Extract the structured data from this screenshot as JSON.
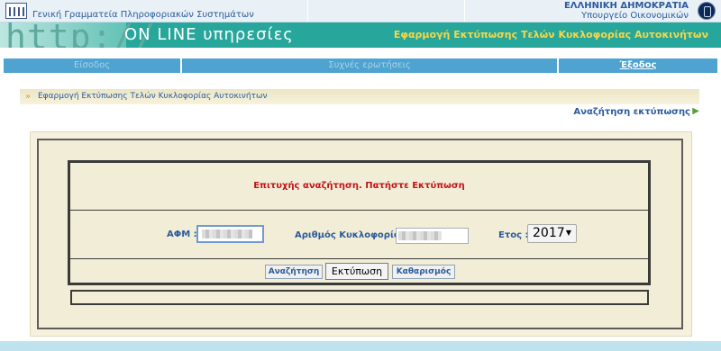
{
  "header": {
    "org_name": "Γενική Γραμματεία Πληροφοριακών Συστημάτων",
    "gov_name": "ΕΛΛΗΝΙΚΗ ΔΗΜΟΚΡΑΤΙΑ",
    "ministry": "Υπουργείο Οικονομικών",
    "logo_icon": "gsis-logo-icon",
    "crest_icon": "greek-crest-icon"
  },
  "banner": {
    "http_text": "http://",
    "online_text": "ON LINE υπηρεσίες",
    "app_title": "Εφαρμογή Εκτύπωσης Τελών Κυκλοφορίας Αυτοκινήτων"
  },
  "nav": {
    "items": [
      {
        "label": "Είσοδος",
        "active": false
      },
      {
        "label": "Συχνές ερωτήσεις",
        "active": false
      },
      {
        "label": "Έξοδος",
        "active": true
      }
    ]
  },
  "breadcrumb": {
    "icon": "double-chevron-right-icon",
    "text": "Εφαρμογή Εκτύπωσης Τελών Κυκλοφορίας Αυτοκινήτων"
  },
  "search_link": {
    "label": "Αναζήτηση εκτύπωσης",
    "icon": "triangle-right-icon"
  },
  "form": {
    "status_message": "Επιτυχής αναζήτηση. Πατήστε Εκτύπωση",
    "afm_label": "ΑΦΜ :",
    "plate_label": "Αριθμός Κυκλοφορίας :",
    "year_label": "Ετος :",
    "year_value": "2017",
    "buttons": {
      "search": "Αναζήτηση",
      "print": "Εκτύπωση",
      "clear": "Καθαρισμός"
    }
  },
  "colors": {
    "banner": "#27a79b",
    "nav": "#4ea3d0",
    "status_text": "#c0141a",
    "label_text": "#2b5b9c",
    "panel_bg": "#f2edd7"
  }
}
